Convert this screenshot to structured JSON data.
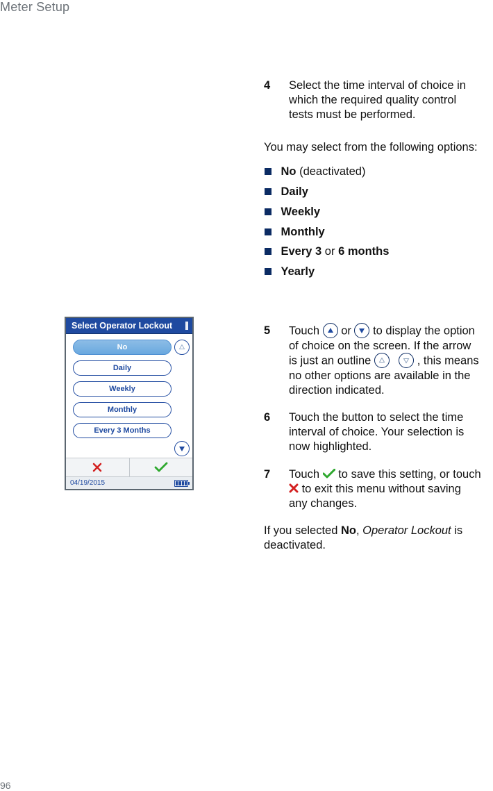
{
  "header": {
    "section": "Meter Setup"
  },
  "footer": {
    "page": "96"
  },
  "steps": {
    "s4": {
      "num": "4",
      "text": "Select the time interval of choice in which the required quality control tests must be performed."
    },
    "intro": "You may select from the following options:",
    "options": [
      {
        "bold": "No",
        "rest": " (deactivated)"
      },
      {
        "bold": "Daily",
        "rest": ""
      },
      {
        "bold": "Weekly",
        "rest": ""
      },
      {
        "bold": "Monthly",
        "rest": ""
      },
      {
        "bold": "Every 3",
        "mid": " or ",
        "bold2": "6 months"
      },
      {
        "bold": "Yearly",
        "rest": ""
      }
    ],
    "s5": {
      "num": "5",
      "part1": "Touch ",
      "part2": " or ",
      "part3": " to display the option of choice on the screen. If the arrow is just an outline ",
      "part4": ", this means no other options are available in the direction indi­cated."
    },
    "s6": {
      "num": "6",
      "text": "Touch the button to select the time interval of choice. Your selection is now high­lighted."
    },
    "s7": {
      "num": "7",
      "part1": "Touch ",
      "part2": " to save this setting, or touch ",
      "part3": " to exit this menu without saving any changes."
    },
    "closing_a": "If you selected ",
    "closing_bold": "No",
    "closing_b": ", ",
    "closing_italic": "Operator Lockout",
    "closing_c": " is deac­tivated."
  },
  "device": {
    "title": "Select Operator Lockout",
    "options": [
      "No",
      "Daily",
      "Weekly",
      "Monthly",
      "Every 3 Months"
    ],
    "selected_index": 0,
    "date": "04/19/2015"
  }
}
